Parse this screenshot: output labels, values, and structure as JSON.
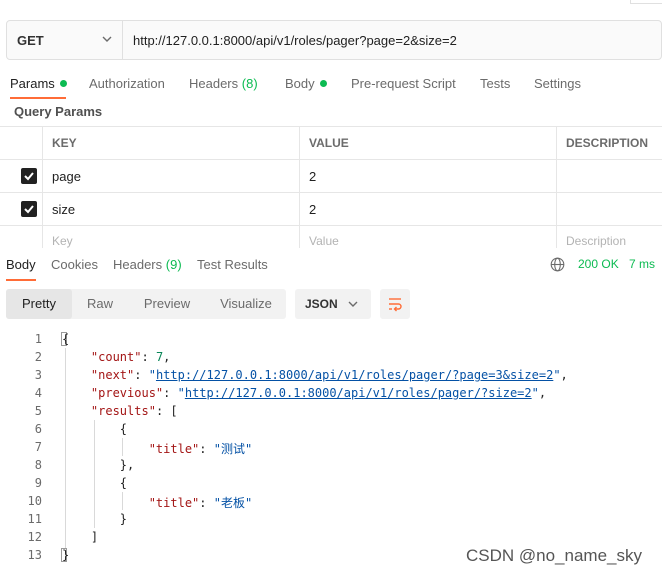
{
  "request": {
    "method": "GET",
    "url": "http://127.0.0.1:8000/api/v1/roles/pager?page=2&size=2"
  },
  "request_tabs": {
    "params": "Params",
    "authorization": "Authorization",
    "headers": "Headers",
    "headers_count": "(8)",
    "body": "Body",
    "prerequest": "Pre-request Script",
    "tests": "Tests",
    "settings": "Settings"
  },
  "query_params": {
    "title": "Query Params",
    "columns": [
      "KEY",
      "VALUE",
      "DESCRIPTION"
    ],
    "rows": [
      {
        "checked": true,
        "key": "page",
        "value": "2"
      },
      {
        "checked": true,
        "key": "size",
        "value": "2"
      }
    ],
    "placeholder": {
      "key": "Key",
      "value": "Value",
      "description": "Description"
    }
  },
  "response_tabs": {
    "body": "Body",
    "cookies": "Cookies",
    "headers": "Headers",
    "headers_count": "(9)",
    "test_results": "Test Results"
  },
  "response_status": {
    "code": "200 OK",
    "time": "7 ms"
  },
  "format_bar": {
    "pretty": "Pretty",
    "raw": "Raw",
    "preview": "Preview",
    "visualize": "Visualize",
    "format": "JSON"
  },
  "code": {
    "line_numbers": [
      "1",
      "2",
      "3",
      "4",
      "5",
      "6",
      "7",
      "8",
      "9",
      "10",
      "11",
      "12",
      "13"
    ],
    "count_key": "\"count\"",
    "count_value": "7",
    "next_key": "\"next\"",
    "next_value": "http://127.0.0.1:8000/api/v1/roles/pager/?page=3&size=2",
    "previous_key": "\"previous\"",
    "previous_value": "http://127.0.0.1:8000/api/v1/roles/pager/?size=2",
    "results_key": "\"results\"",
    "title_key": "\"title\"",
    "title_value_1": "\"测试\"",
    "title_value_2": "\"老板\""
  },
  "watermark": "CSDN @no_name_sky",
  "colors": {
    "accent": "#ff6c37",
    "success": "#0cbb52",
    "json_key": "#a31515",
    "json_string": "#0451a5",
    "json_number": "#098658"
  }
}
